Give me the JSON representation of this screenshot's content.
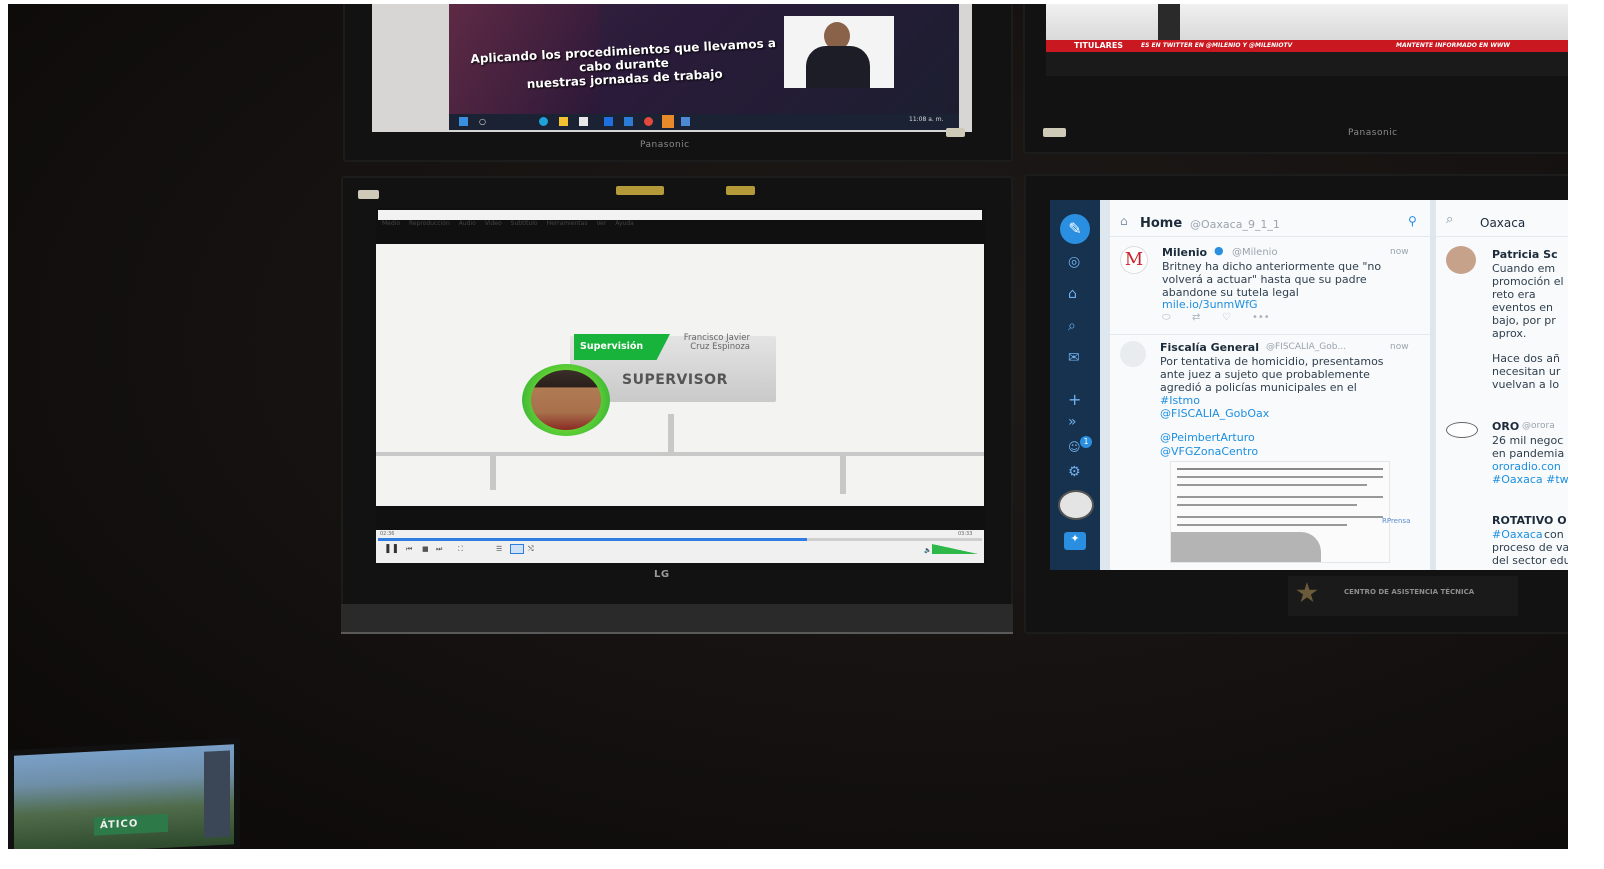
{
  "monitor_top_left": {
    "brand": "Panasonic",
    "subtitle_line1": "Aplicando los procedimientos que llevamos a cabo durante",
    "subtitle_line2": "nuestras jornadas de trabajo",
    "clock": "11:08 a. m."
  },
  "monitor_top_right": {
    "brand": "Panasonic",
    "ticker_label": "TITULARES",
    "ticker_text": "ES EN TWITTER EN @MILENIO Y @MILENIOTV",
    "ticker_text_2": "MANTENTE INFORMADO EN WWW"
  },
  "media_player": {
    "brand": "LG",
    "menu": [
      "Medio",
      "Reproducción",
      "Audio",
      "Video",
      "Subtítulo",
      "Herramientas",
      "Ver",
      "Ayuda"
    ],
    "org_chart": {
      "tag": "Supervisión",
      "person_name_line1": "Francisco Javier",
      "person_name_line2": "Cruz Espinoza",
      "role": "SUPERVISOR"
    },
    "time_elapsed": "02:36",
    "time_total": "03:33",
    "progress": 0.71
  },
  "tweetdeck": {
    "column_home": {
      "title": "Home",
      "handle": "@Oaxaca_9_1_1"
    },
    "column_search": {
      "title": "Oaxaca"
    },
    "tweets": [
      {
        "name": "Milenio",
        "handle": "@Milenio",
        "time": "now",
        "text": "Britney ha dicho anteriormente que \"no volverá a actuar\" hasta que su padre abandone su tutela legal",
        "link": "mile.io/3unmWfG"
      },
      {
        "name": "Fiscalía General",
        "handle": "@FISCALIA_Gob...",
        "time": "now",
        "text": "Por tentativa de homicidio, presentamos ante juez a sujeto que probablemente agredió a policías municipales en el",
        "hashtag": "#Istmo",
        "mention_1": "@FISCALIA_GobOax",
        "mention_2": "@PeimbertArturo",
        "mention_3": "@VFGZonaCentro"
      }
    ],
    "side_tweets": [
      {
        "name": "Patricia Sc",
        "text": "Cuando em promoción el reto era eventos en bajo, por pr aprox.",
        "text_2": "Hace dos añ necesitan ur vuelvan a lo"
      },
      {
        "name": "ORO",
        "handle": "@orora",
        "text": "26 mil negoc en pandemia",
        "link": "ororadio.con",
        "hashtag": "#Oaxaca #tw"
      },
      {
        "name": "ROTATIVO O",
        "hashtag": "#Oaxaca",
        "text": "con proceso de va del sector edu"
      }
    ],
    "badge_count": "1",
    "embedded_link": "RPrensa"
  },
  "lower_console": {
    "sign_text": "CENTRO DE ASISTENCIA TÉCNICA",
    "small_monitor_sign": "ÁTICO"
  },
  "colors": {
    "accent_green": "#2fb84a",
    "tweet_link": "#1d8fe0",
    "tweetdeck_sidebar": "#1e3a5c",
    "ticker_red": "#d01c22",
    "progress_blue": "#2f7de0"
  }
}
